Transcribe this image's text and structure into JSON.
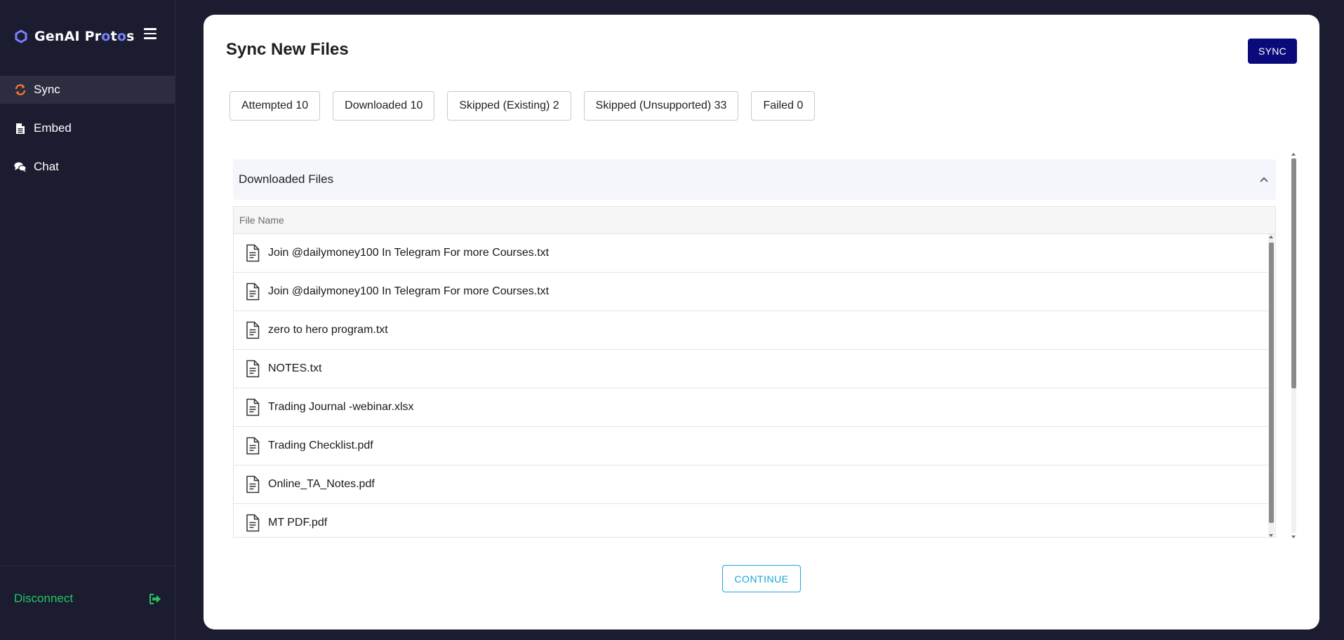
{
  "app": {
    "brand_prefix": "GenAI Pr",
    "brand_o": "o",
    "brand_mid": "t",
    "brand_o2": "o",
    "brand_suffix": "s"
  },
  "sidebar": {
    "items": [
      {
        "label": "Sync",
        "icon": "sync-icon",
        "active": true
      },
      {
        "label": "Embed",
        "icon": "file-icon",
        "active": false
      },
      {
        "label": "Chat",
        "icon": "chat-icon",
        "active": false
      }
    ],
    "disconnect_label": "Disconnect",
    "disconnect_icon": "sign-out-icon"
  },
  "colors": {
    "accent_sync": "#f5772c",
    "disconnect": "#22c55e",
    "sync_button": "#0a0a7a",
    "continue": "#1aa7d6"
  },
  "main": {
    "title": "Sync New Files",
    "sync_label": "SYNC",
    "stats": [
      {
        "label": "Attempted 10"
      },
      {
        "label": "Downloaded 10"
      },
      {
        "label": "Skipped (Existing) 2"
      },
      {
        "label": "Skipped (Unsupported) 33"
      },
      {
        "label": "Failed 0"
      }
    ],
    "accordion": {
      "title": "Downloaded Files",
      "expanded": true,
      "column_header": "File Name",
      "files": [
        "Join @dailymoney100 In Telegram For more Courses.txt",
        "Join @dailymoney100 In Telegram For more Courses.txt",
        "zero to hero program.txt",
        "NOTES.txt",
        "Trading Journal -webinar.xlsx",
        "Trading Checklist.pdf",
        "Online_TA_Notes.pdf",
        "MT PDF.pdf"
      ]
    },
    "continue_label": "CONTINUE"
  }
}
